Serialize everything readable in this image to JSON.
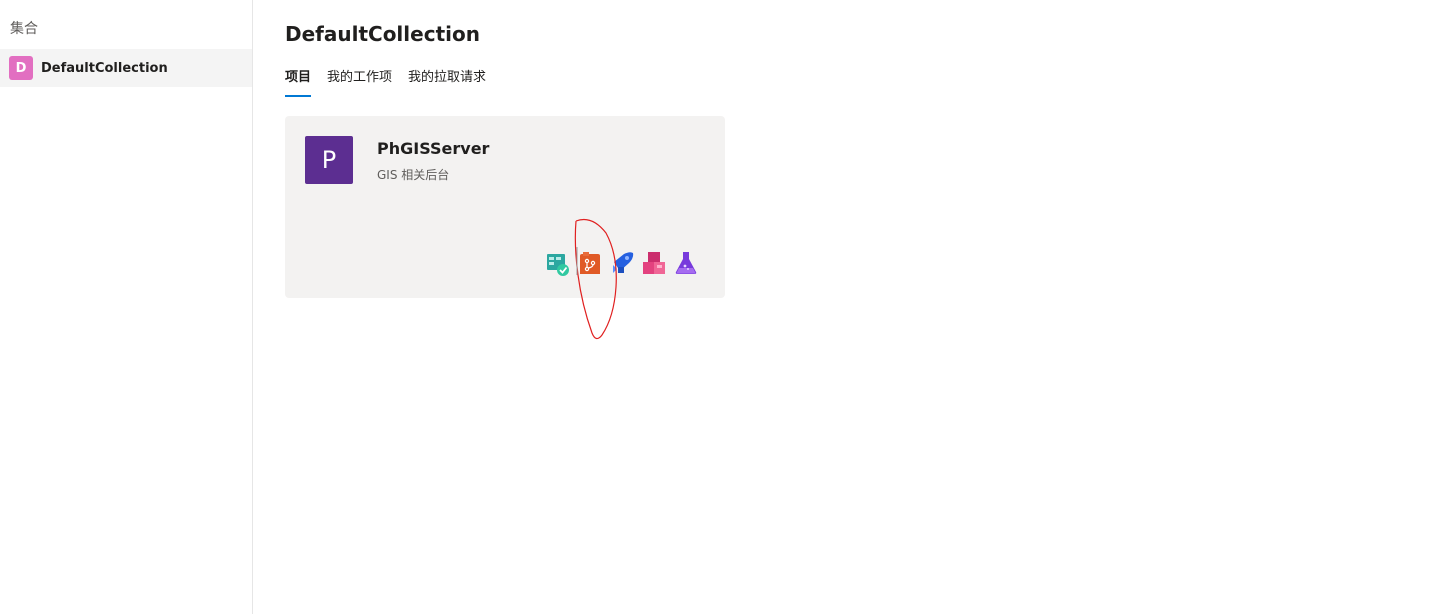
{
  "sidebar": {
    "heading": "集合",
    "items": [
      {
        "initial": "D",
        "label": "DefaultCollection",
        "color": "#e26fc1"
      }
    ]
  },
  "main": {
    "title": "DefaultCollection",
    "tabs": [
      {
        "label": "项目",
        "active": true
      },
      {
        "label": "我的工作项",
        "active": false
      },
      {
        "label": "我的拉取请求",
        "active": false
      }
    ]
  },
  "project": {
    "initial": "P",
    "name": "PhGISServer",
    "description": "GIS 相关后台",
    "color": "#5c2e91",
    "services": [
      {
        "icon": "boards-icon",
        "color": "#009ccc"
      },
      {
        "icon": "repos-icon",
        "color": "#e05a26"
      },
      {
        "icon": "pipelines-icon",
        "color": "#2560e0"
      },
      {
        "icon": "artifacts-icon",
        "color": "#cb2e6d"
      },
      {
        "icon": "test-plans-icon",
        "color": "#773adc"
      }
    ]
  },
  "colors": {
    "accent": "#0078d4",
    "annotation": "#e02020"
  }
}
